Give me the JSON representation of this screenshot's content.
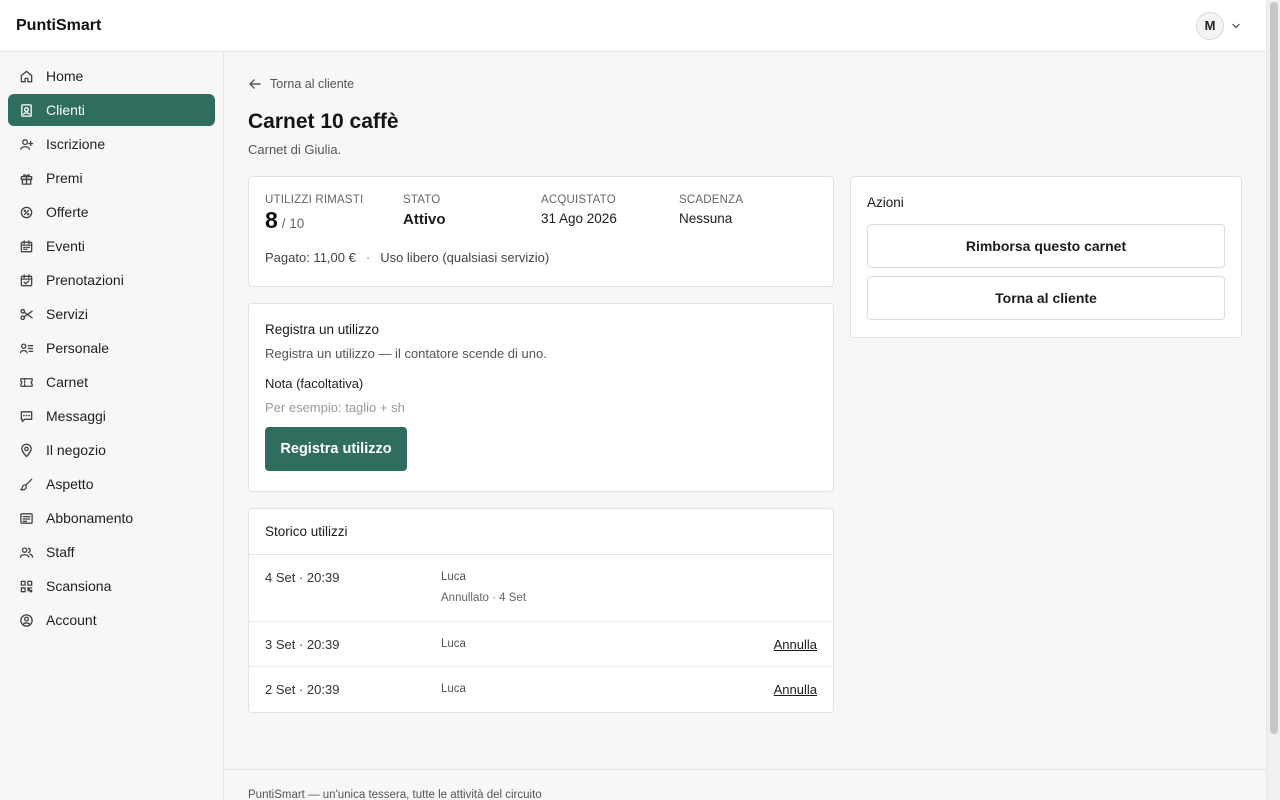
{
  "app": {
    "brand": "PuntiSmart"
  },
  "user": {
    "initial": "M"
  },
  "sidebar": {
    "items": [
      {
        "label": "Home",
        "icon": "home-icon"
      },
      {
        "label": "Clienti",
        "icon": "contacts-icon",
        "active": true
      },
      {
        "label": "Iscrizione",
        "icon": "user-plus-icon"
      },
      {
        "label": "Premi",
        "icon": "gift-icon"
      },
      {
        "label": "Offerte",
        "icon": "tag-icon"
      },
      {
        "label": "Eventi",
        "icon": "calendar-icon"
      },
      {
        "label": "Prenotazioni",
        "icon": "calendar-check-icon"
      },
      {
        "label": "Servizi",
        "icon": "scissors-icon"
      },
      {
        "label": "Personale",
        "icon": "staff-list-icon"
      },
      {
        "label": "Carnet",
        "icon": "ticket-icon"
      },
      {
        "label": "Messaggi",
        "icon": "message-icon"
      },
      {
        "label": "Il negozio",
        "icon": "map-pin-icon"
      },
      {
        "label": "Aspetto",
        "icon": "brush-icon"
      },
      {
        "label": "Abbonamento",
        "icon": "receipt-icon"
      },
      {
        "label": "Staff",
        "icon": "users-icon"
      },
      {
        "label": "Scansiona",
        "icon": "qr-icon"
      },
      {
        "label": "Account",
        "icon": "account-icon"
      }
    ]
  },
  "main": {
    "back_label": "Torna al cliente",
    "title": "Carnet 10 caffè",
    "subtitle": "Carnet di Giulia.",
    "summary": {
      "remaining_label": "UTILIZZI RIMASTI",
      "remaining": "8",
      "total": "/ 10",
      "status_label": "STATO",
      "status": "Attivo",
      "purchased_label": "ACQUISTATO",
      "purchased": "31 Ago 2026",
      "expiry_label": "SCADENZA",
      "expiry": "Nessuna",
      "paid": "Pagato: 11,00 €",
      "separator": "·",
      "usage": "Uso libero (qualsiasi servizio)"
    },
    "register": {
      "title": "Registra un utilizzo",
      "description": "Registra un utilizzo — il contatore scende di uno.",
      "note_label": "Nota (facoltativa)",
      "note_value": "",
      "note_placeholder": "Per esempio: taglio + sh",
      "button": "Registra utilizzo"
    },
    "history": {
      "title": "Storico utilizzi",
      "rows": [
        {
          "when": "4 Set · 20:39",
          "who": "Luca",
          "note": "Annullato · 4 Set",
          "action": ""
        },
        {
          "when": "3 Set · 20:39",
          "who": "Luca",
          "note": "",
          "action": "Annulla"
        },
        {
          "when": "2 Set · 20:39",
          "who": "Luca",
          "note": "",
          "action": "Annulla"
        }
      ]
    },
    "actions": {
      "title": "Azioni",
      "refund": "Rimborsa questo carnet",
      "back": "Torna al cliente"
    }
  },
  "footer": {
    "text": "PuntiSmart — un'unica tessera, tutte le attività del circuito"
  },
  "colors": {
    "accent": "#2f6e5e",
    "border": "#e2e2e2",
    "background": "#f7f7f7"
  }
}
